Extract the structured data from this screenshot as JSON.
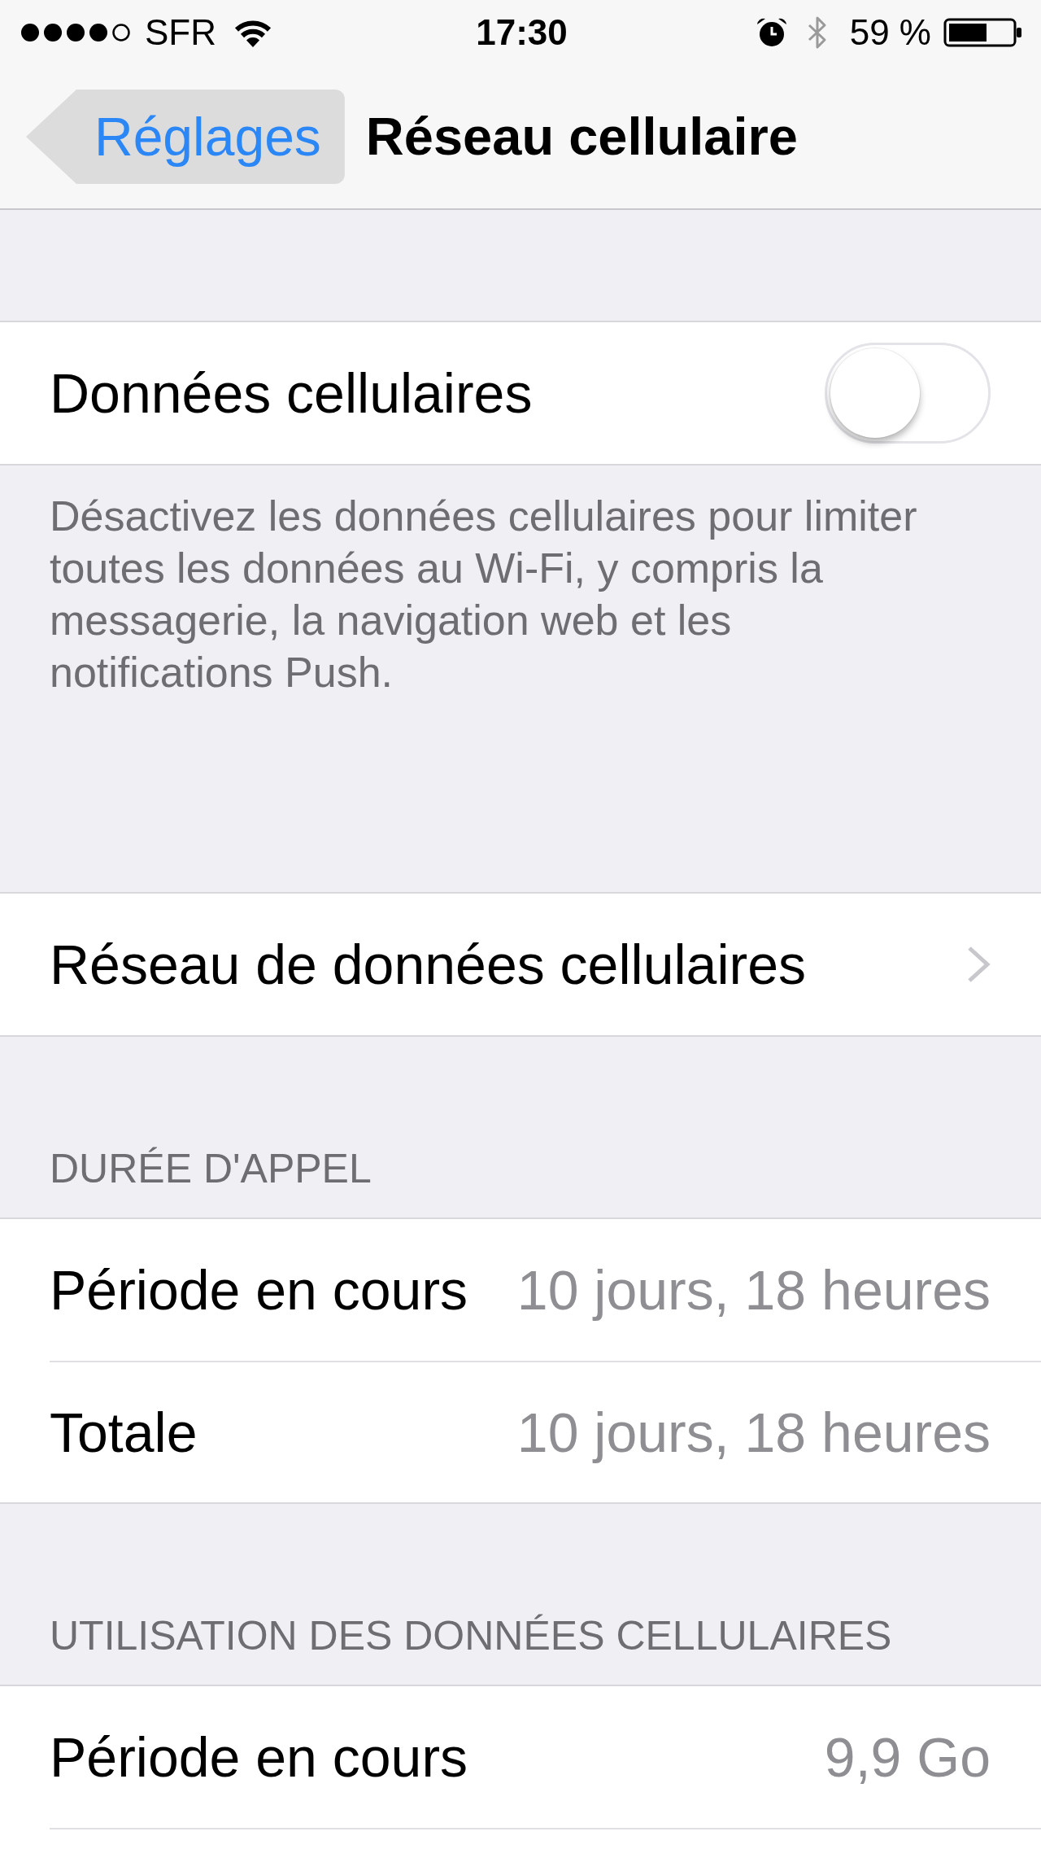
{
  "status_bar": {
    "carrier": "SFR",
    "time": "17:30",
    "battery": "59 %"
  },
  "nav_bar": {
    "back_button": "Réglages",
    "title": "Réseau cellulaire"
  },
  "sections": [
    {
      "rows": [
        {
          "kind": "switch",
          "label": "Données cellulaires",
          "on": false
        }
      ],
      "footer": "Désactivez les données cellulaires pour limiter toutes les données au Wi-Fi, y compris la messagerie, la navigation web et les notifications Push."
    },
    {
      "rows": [
        {
          "kind": "link",
          "label": "Réseau de données cellulaires"
        }
      ]
    },
    {
      "header": "DURÉE D'APPEL",
      "rows": [
        {
          "kind": "value",
          "label": "Période en cours",
          "value": "10 jours, 18 heures"
        },
        {
          "kind": "value",
          "label": "Totale",
          "value": "10 jours, 18 heures"
        }
      ]
    },
    {
      "header": "UTILISATION DES DONNÉES CELLULAIRES",
      "rows": [
        {
          "kind": "value",
          "label": "Période en cours",
          "value": "9,9 Go"
        }
      ]
    }
  ]
}
